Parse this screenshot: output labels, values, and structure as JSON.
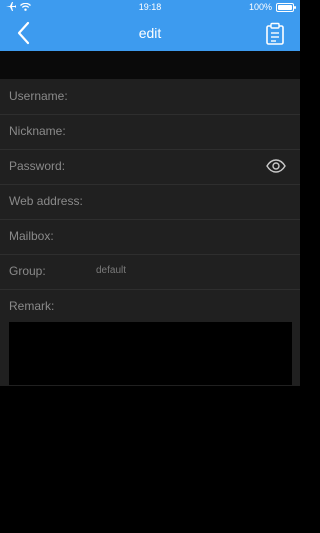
{
  "status_bar": {
    "time": "19:18",
    "battery": "100%"
  },
  "nav": {
    "title": "edit"
  },
  "fields": [
    {
      "label": "Username:",
      "value": ""
    },
    {
      "label": "Nickname:",
      "value": ""
    },
    {
      "label": "Password:",
      "value": ""
    },
    {
      "label": "Web address:",
      "value": ""
    },
    {
      "label": "Mailbox:",
      "value": ""
    },
    {
      "label": "Group:",
      "value": "default"
    }
  ],
  "remark": {
    "label": "Remark:",
    "value": ""
  },
  "colors": {
    "accent": "#3d9bef",
    "background": "#000000",
    "panel": "#202020"
  },
  "icons": [
    "airplane-icon",
    "wifi-icon",
    "battery-icon",
    "back-icon",
    "clipboard-icon",
    "eye-icon"
  ]
}
